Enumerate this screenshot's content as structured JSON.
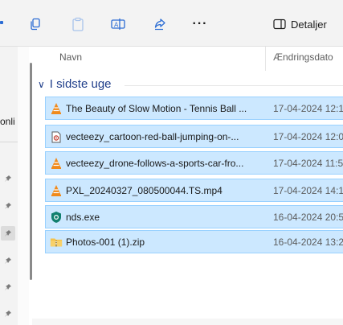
{
  "toolbar": {
    "details_label": "Detaljer",
    "more_label": "···"
  },
  "nav": {
    "partial_text": "onli"
  },
  "columns": {
    "name": "Navn",
    "modified": "Ændringsdato"
  },
  "group": {
    "label": "I sidste uge",
    "chevron": "∨"
  },
  "files": [
    {
      "name": "The Beauty of Slow Motion - Tennis Ball ...",
      "date": "17-04-2024 12:1",
      "icon": "vlc-icon"
    },
    {
      "name": "vecteezy_cartoon-red-ball-jumping-on-...",
      "date": "17-04-2024 12:0",
      "icon": "video-file-icon"
    },
    {
      "name": "vecteezy_drone-follows-a-sports-car-fro...",
      "date": "17-04-2024 11:5",
      "icon": "vlc-icon"
    },
    {
      "name": "PXL_20240327_080500044.TS.mp4",
      "date": "17-04-2024 14:1",
      "icon": "vlc-icon"
    },
    {
      "name": "nds.exe",
      "date": "16-04-2024 20:5",
      "icon": "shield-exe-icon"
    },
    {
      "name": "Photos-001 (1).zip",
      "date": "16-04-2024 13:2",
      "icon": "zip-folder-icon"
    }
  ],
  "colors": {
    "selection_bg": "#cce8ff",
    "selection_border": "#99d1ff",
    "group_text": "#1f3e8a"
  }
}
